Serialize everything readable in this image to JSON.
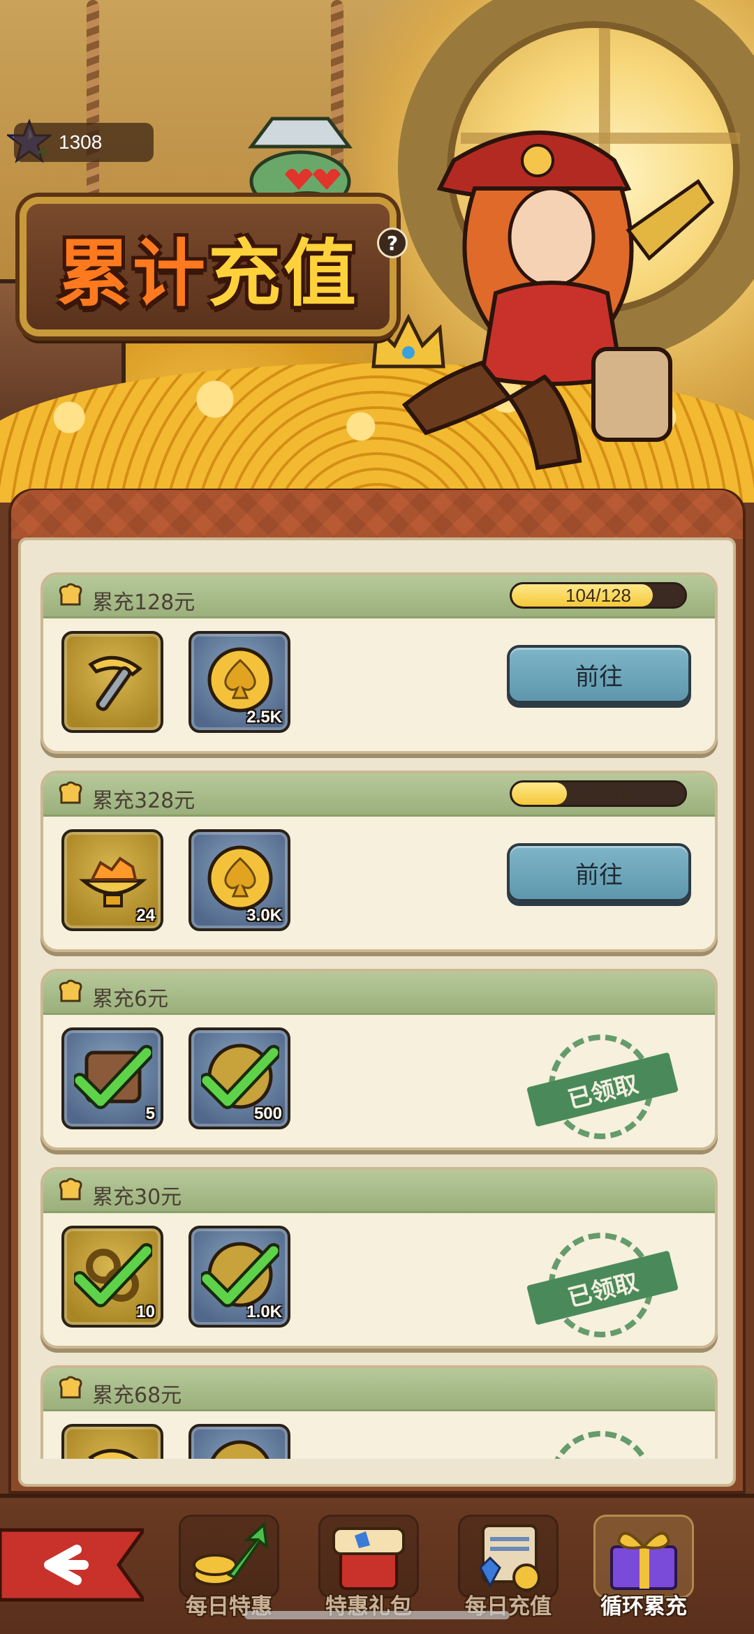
{
  "header": {
    "gem_count": "1308",
    "title": "累计充值",
    "help": "?"
  },
  "colors": {
    "accent_title": "#ff7a1e",
    "header_green": "#9bb07c",
    "go_button": "#5e97ad",
    "stamp_green": "#4a8a5a",
    "progress_fill": "#f4c93a"
  },
  "tiers": [
    {
      "title": "累充128元",
      "progress": "104/128",
      "progress_fraction": 0.8125,
      "items": [
        {
          "icon": "pickaxe-icon",
          "qty": ""
        },
        {
          "icon": "spade-coin-icon",
          "qty": "2.5K"
        }
      ],
      "action": "前往",
      "claimed": false
    },
    {
      "title": "累充328元",
      "progress": "104/328",
      "progress_fraction": 0.317,
      "items": [
        {
          "icon": "gold-ore-bowl-icon",
          "qty": "24"
        },
        {
          "icon": "spade-coin-icon",
          "qty": "3.0K"
        }
      ],
      "action": "前往",
      "claimed": false
    },
    {
      "title": "累充6元",
      "items": [
        {
          "icon": "cracker-icon",
          "qty": "5"
        },
        {
          "icon": "coin-icon",
          "qty": "500"
        }
      ],
      "status": "已领取",
      "claimed": true
    },
    {
      "title": "累充30元",
      "items": [
        {
          "icon": "ring-icon",
          "qty": "10"
        },
        {
          "icon": "coin-icon",
          "qty": "1.0K"
        }
      ],
      "status": "已领取",
      "claimed": true
    },
    {
      "title": "累充68元",
      "items": [
        {
          "icon": "pickaxe-icon",
          "qty": ""
        },
        {
          "icon": "coin-icon",
          "qty": ""
        }
      ],
      "claimed": true
    }
  ],
  "nav": {
    "tabs": [
      {
        "label": "每日特惠",
        "icon": "coins-arrow-icon",
        "active": false
      },
      {
        "label": "特惠礼包",
        "icon": "gift-pack-icon",
        "active": false
      },
      {
        "label": "每日充值",
        "icon": "daily-recharge-icon",
        "active": false
      },
      {
        "label": "循环累充",
        "icon": "gift-box-icon",
        "active": true
      }
    ]
  }
}
